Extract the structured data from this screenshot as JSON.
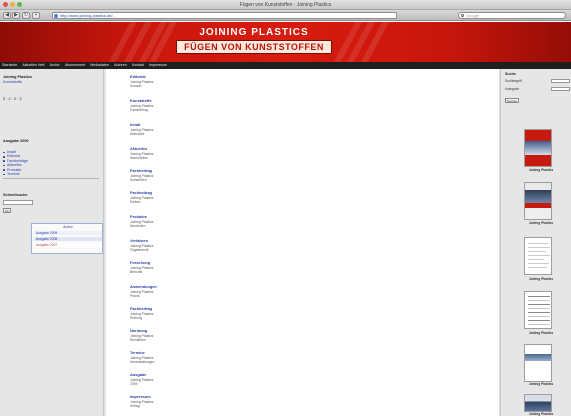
{
  "browser": {
    "window_title": "Fügen von Kunststoffen · Joining Plastics",
    "url": "http://www.joining-plastics.de/...",
    "search_placeholder": "Google"
  },
  "banner": {
    "logo_top": "JOINING PLASTICS",
    "logo_bottom": "FÜGEN VON KUNSTSTOFFEN",
    "color": "#d01a0e"
  },
  "nav": {
    "items": [
      "Startseite",
      "Aktuelles Heft",
      "Archiv",
      "Abonnement",
      "Mediadaten",
      "Autoren",
      "Kontakt",
      "Impressum"
    ]
  },
  "sidebar_left": {
    "block1": [
      "Joining Plastics",
      "Kunststoffe",
      "2 · 2 · 2 · 2"
    ],
    "block2_head": "Ausgabe 2009",
    "block2_list": [
      "Inhalt",
      "Editorial",
      "Fachbeiträge",
      "Aktuelles",
      "Produkte",
      "Termine"
    ],
    "search_heading": "Schnellsuche",
    "search_button": "OK",
    "popup_title": "Archiv",
    "popup_items": [
      "Ausgabe 2009",
      "Ausgabe 2008",
      "Ausgabe 2007"
    ]
  },
  "main": {
    "entries": [
      {
        "title": "Editorial",
        "meta": "Joining Plastics",
        "meta2": "Vorwort"
      },
      {
        "title": "Kunststoffe",
        "meta": "Joining Plastics",
        "meta2": "Fachbeitrag"
      },
      {
        "title": "Inhalt",
        "meta": "Joining Plastics",
        "meta2": "Übersicht"
      },
      {
        "title": "Aktuelles",
        "meta": "Joining Plastics",
        "meta2": "Nachrichten"
      },
      {
        "title": "Fachbeitrag",
        "meta": "Joining Plastics",
        "meta2": "Schweißen"
      },
      {
        "title": "Fachbeitrag",
        "meta": "Joining Plastics",
        "meta2": "Kleben"
      },
      {
        "title": "Produkte",
        "meta": "Joining Plastics",
        "meta2": "Neuheiten"
      },
      {
        "title": "Verfahren",
        "meta": "Joining Plastics",
        "meta2": "Fügetechnik"
      },
      {
        "title": "Forschung",
        "meta": "Joining Plastics",
        "meta2": "Berichte"
      },
      {
        "title": "Anwendungen",
        "meta": "Joining Plastics",
        "meta2": "Praxis"
      },
      {
        "title": "Fachbeitrag",
        "meta": "Joining Plastics",
        "meta2": "Prüfung"
      },
      {
        "title": "Normung",
        "meta": "Joining Plastics",
        "meta2": "Richtlinien"
      },
      {
        "title": "Termine",
        "meta": "Joining Plastics",
        "meta2": "Veranstaltungen"
      },
      {
        "title": "Ausgabe",
        "meta": "Joining Plastics",
        "meta2": "2009"
      },
      {
        "title": "Impressum",
        "meta": "Joining Plastics",
        "meta2": "Verlag"
      }
    ]
  },
  "right_col": {
    "heading": "Suche",
    "label1": "Suchbegriff",
    "label2": "Kategorie",
    "button": "Suchen",
    "caption": "Joining Plastics"
  }
}
